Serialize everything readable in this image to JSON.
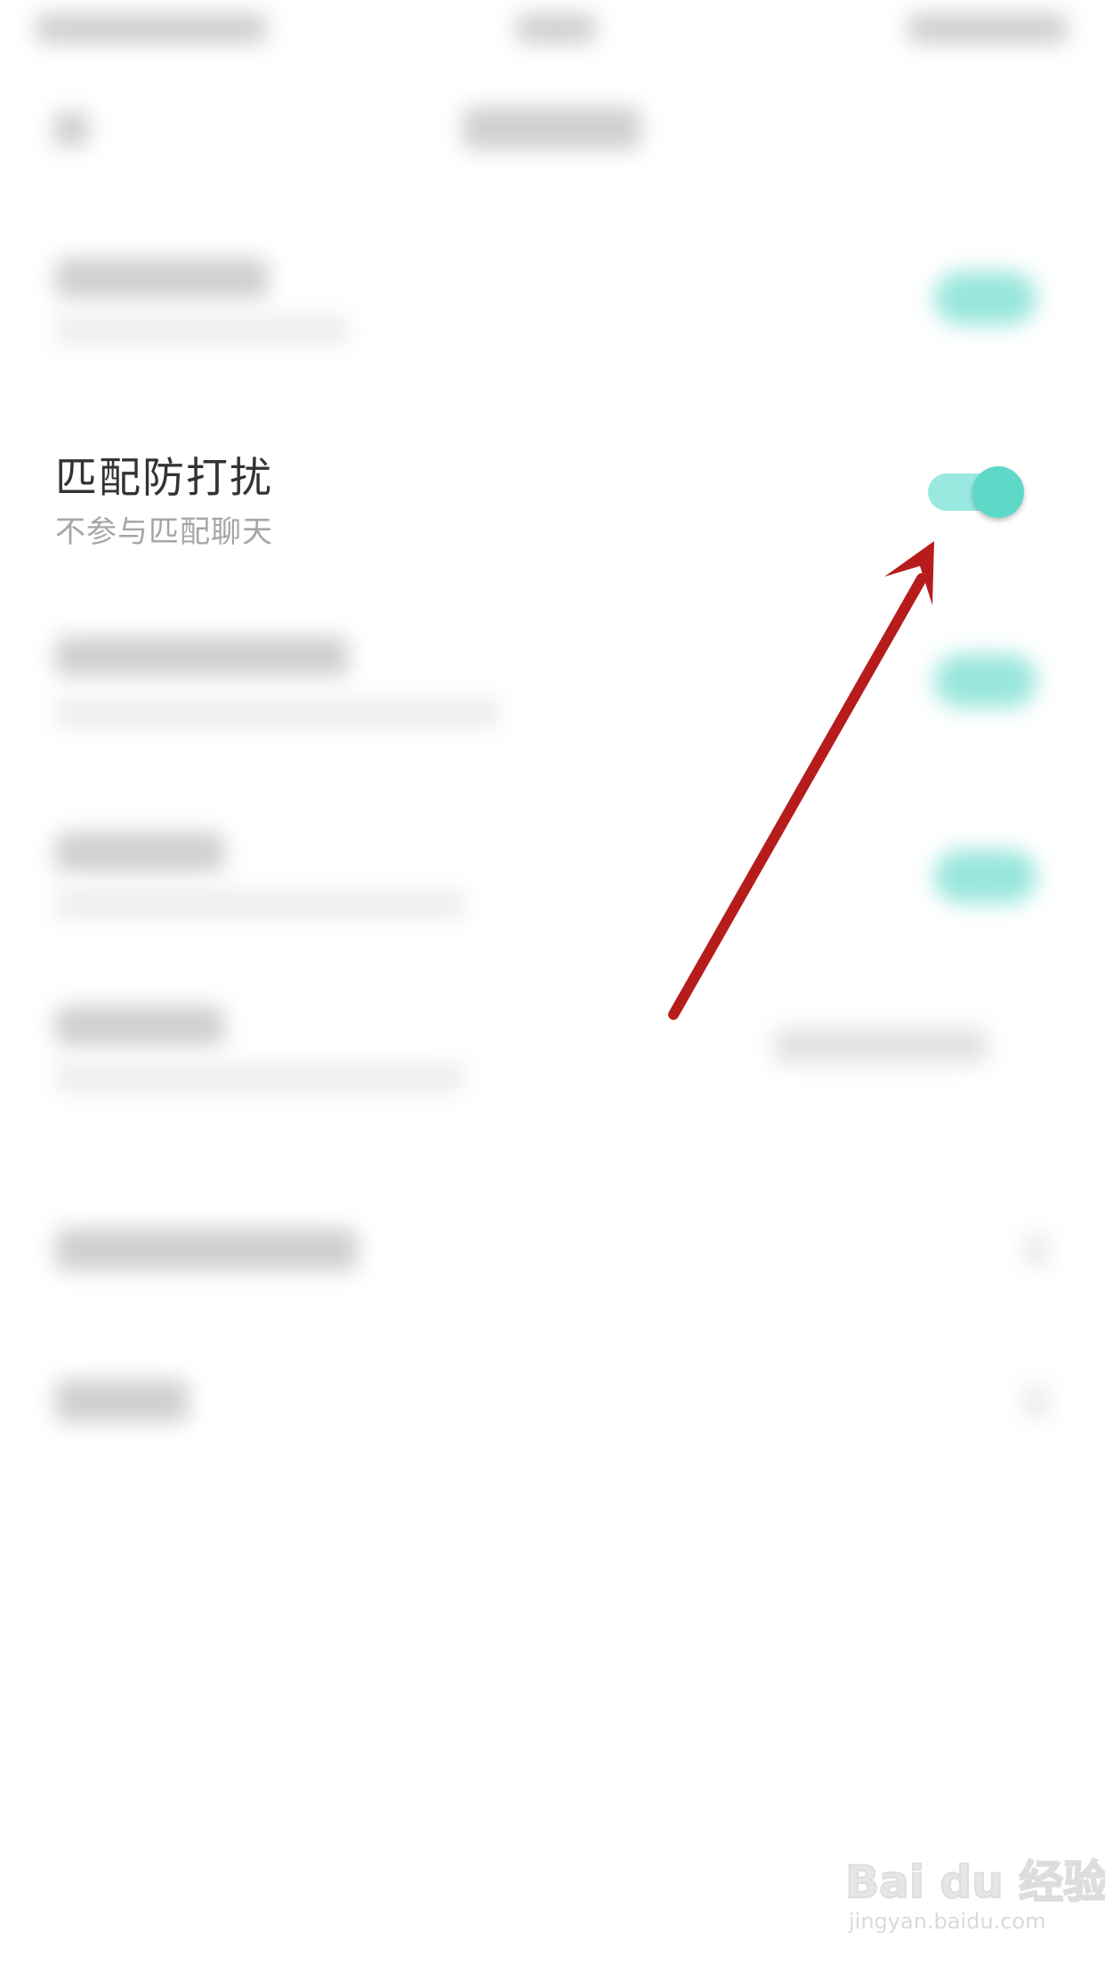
{
  "settings_item": {
    "title": "匹配防打扰",
    "subtitle": "不参与匹配聊天",
    "toggle_state": "on"
  },
  "colors": {
    "toggle_track": "#9ae9e0",
    "toggle_knob": "#5ed9c8",
    "arrow": "#b71c1c"
  },
  "icons": {
    "annotation": "arrow-annotation-icon",
    "watermark": "baidu-jingyan-logo"
  },
  "watermark": {
    "brand": "Bai du 经验",
    "url": "jingyan.baidu.com"
  }
}
